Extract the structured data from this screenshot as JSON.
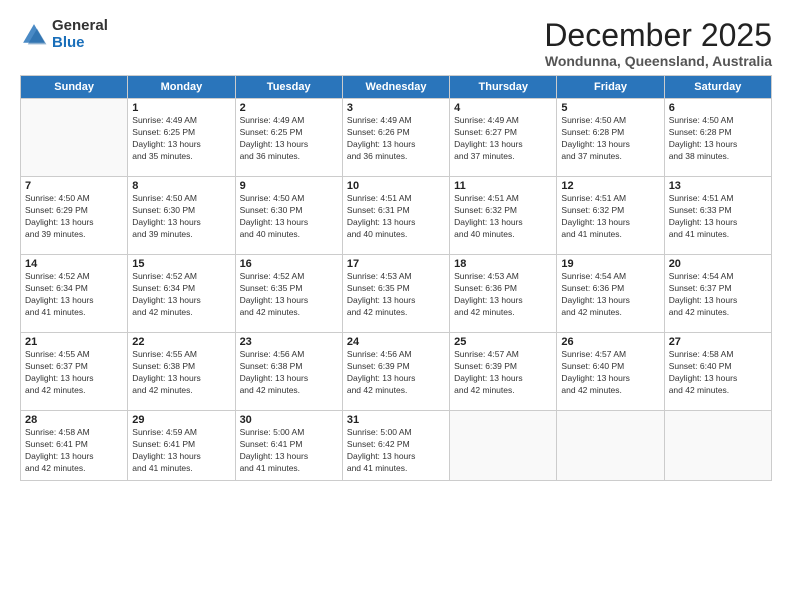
{
  "logo": {
    "general": "General",
    "blue": "Blue"
  },
  "title": "December 2025",
  "subtitle": "Wondunna, Queensland, Australia",
  "days_of_week": [
    "Sunday",
    "Monday",
    "Tuesday",
    "Wednesday",
    "Thursday",
    "Friday",
    "Saturday"
  ],
  "weeks": [
    [
      {
        "day": "",
        "sunrise": "",
        "sunset": "",
        "daylight": ""
      },
      {
        "day": "1",
        "sunrise": "Sunrise: 4:49 AM",
        "sunset": "Sunset: 6:25 PM",
        "daylight": "Daylight: 13 hours and 35 minutes."
      },
      {
        "day": "2",
        "sunrise": "Sunrise: 4:49 AM",
        "sunset": "Sunset: 6:25 PM",
        "daylight": "Daylight: 13 hours and 36 minutes."
      },
      {
        "day": "3",
        "sunrise": "Sunrise: 4:49 AM",
        "sunset": "Sunset: 6:26 PM",
        "daylight": "Daylight: 13 hours and 36 minutes."
      },
      {
        "day": "4",
        "sunrise": "Sunrise: 4:49 AM",
        "sunset": "Sunset: 6:27 PM",
        "daylight": "Daylight: 13 hours and 37 minutes."
      },
      {
        "day": "5",
        "sunrise": "Sunrise: 4:50 AM",
        "sunset": "Sunset: 6:28 PM",
        "daylight": "Daylight: 13 hours and 37 minutes."
      },
      {
        "day": "6",
        "sunrise": "Sunrise: 4:50 AM",
        "sunset": "Sunset: 6:28 PM",
        "daylight": "Daylight: 13 hours and 38 minutes."
      }
    ],
    [
      {
        "day": "7",
        "sunrise": "Sunrise: 4:50 AM",
        "sunset": "Sunset: 6:29 PM",
        "daylight": "Daylight: 13 hours and 39 minutes."
      },
      {
        "day": "8",
        "sunrise": "Sunrise: 4:50 AM",
        "sunset": "Sunset: 6:30 PM",
        "daylight": "Daylight: 13 hours and 39 minutes."
      },
      {
        "day": "9",
        "sunrise": "Sunrise: 4:50 AM",
        "sunset": "Sunset: 6:30 PM",
        "daylight": "Daylight: 13 hours and 40 minutes."
      },
      {
        "day": "10",
        "sunrise": "Sunrise: 4:51 AM",
        "sunset": "Sunset: 6:31 PM",
        "daylight": "Daylight: 13 hours and 40 minutes."
      },
      {
        "day": "11",
        "sunrise": "Sunrise: 4:51 AM",
        "sunset": "Sunset: 6:32 PM",
        "daylight": "Daylight: 13 hours and 40 minutes."
      },
      {
        "day": "12",
        "sunrise": "Sunrise: 4:51 AM",
        "sunset": "Sunset: 6:32 PM",
        "daylight": "Daylight: 13 hours and 41 minutes."
      },
      {
        "day": "13",
        "sunrise": "Sunrise: 4:51 AM",
        "sunset": "Sunset: 6:33 PM",
        "daylight": "Daylight: 13 hours and 41 minutes."
      }
    ],
    [
      {
        "day": "14",
        "sunrise": "Sunrise: 4:52 AM",
        "sunset": "Sunset: 6:34 PM",
        "daylight": "Daylight: 13 hours and 41 minutes."
      },
      {
        "day": "15",
        "sunrise": "Sunrise: 4:52 AM",
        "sunset": "Sunset: 6:34 PM",
        "daylight": "Daylight: 13 hours and 42 minutes."
      },
      {
        "day": "16",
        "sunrise": "Sunrise: 4:52 AM",
        "sunset": "Sunset: 6:35 PM",
        "daylight": "Daylight: 13 hours and 42 minutes."
      },
      {
        "day": "17",
        "sunrise": "Sunrise: 4:53 AM",
        "sunset": "Sunset: 6:35 PM",
        "daylight": "Daylight: 13 hours and 42 minutes."
      },
      {
        "day": "18",
        "sunrise": "Sunrise: 4:53 AM",
        "sunset": "Sunset: 6:36 PM",
        "daylight": "Daylight: 13 hours and 42 minutes."
      },
      {
        "day": "19",
        "sunrise": "Sunrise: 4:54 AM",
        "sunset": "Sunset: 6:36 PM",
        "daylight": "Daylight: 13 hours and 42 minutes."
      },
      {
        "day": "20",
        "sunrise": "Sunrise: 4:54 AM",
        "sunset": "Sunset: 6:37 PM",
        "daylight": "Daylight: 13 hours and 42 minutes."
      }
    ],
    [
      {
        "day": "21",
        "sunrise": "Sunrise: 4:55 AM",
        "sunset": "Sunset: 6:37 PM",
        "daylight": "Daylight: 13 hours and 42 minutes."
      },
      {
        "day": "22",
        "sunrise": "Sunrise: 4:55 AM",
        "sunset": "Sunset: 6:38 PM",
        "daylight": "Daylight: 13 hours and 42 minutes."
      },
      {
        "day": "23",
        "sunrise": "Sunrise: 4:56 AM",
        "sunset": "Sunset: 6:38 PM",
        "daylight": "Daylight: 13 hours and 42 minutes."
      },
      {
        "day": "24",
        "sunrise": "Sunrise: 4:56 AM",
        "sunset": "Sunset: 6:39 PM",
        "daylight": "Daylight: 13 hours and 42 minutes."
      },
      {
        "day": "25",
        "sunrise": "Sunrise: 4:57 AM",
        "sunset": "Sunset: 6:39 PM",
        "daylight": "Daylight: 13 hours and 42 minutes."
      },
      {
        "day": "26",
        "sunrise": "Sunrise: 4:57 AM",
        "sunset": "Sunset: 6:40 PM",
        "daylight": "Daylight: 13 hours and 42 minutes."
      },
      {
        "day": "27",
        "sunrise": "Sunrise: 4:58 AM",
        "sunset": "Sunset: 6:40 PM",
        "daylight": "Daylight: 13 hours and 42 minutes."
      }
    ],
    [
      {
        "day": "28",
        "sunrise": "Sunrise: 4:58 AM",
        "sunset": "Sunset: 6:41 PM",
        "daylight": "Daylight: 13 hours and 42 minutes."
      },
      {
        "day": "29",
        "sunrise": "Sunrise: 4:59 AM",
        "sunset": "Sunset: 6:41 PM",
        "daylight": "Daylight: 13 hours and 41 minutes."
      },
      {
        "day": "30",
        "sunrise": "Sunrise: 5:00 AM",
        "sunset": "Sunset: 6:41 PM",
        "daylight": "Daylight: 13 hours and 41 minutes."
      },
      {
        "day": "31",
        "sunrise": "Sunrise: 5:00 AM",
        "sunset": "Sunset: 6:42 PM",
        "daylight": "Daylight: 13 hours and 41 minutes."
      },
      {
        "day": "",
        "sunrise": "",
        "sunset": "",
        "daylight": ""
      },
      {
        "day": "",
        "sunrise": "",
        "sunset": "",
        "daylight": ""
      },
      {
        "day": "",
        "sunrise": "",
        "sunset": "",
        "daylight": ""
      }
    ]
  ]
}
